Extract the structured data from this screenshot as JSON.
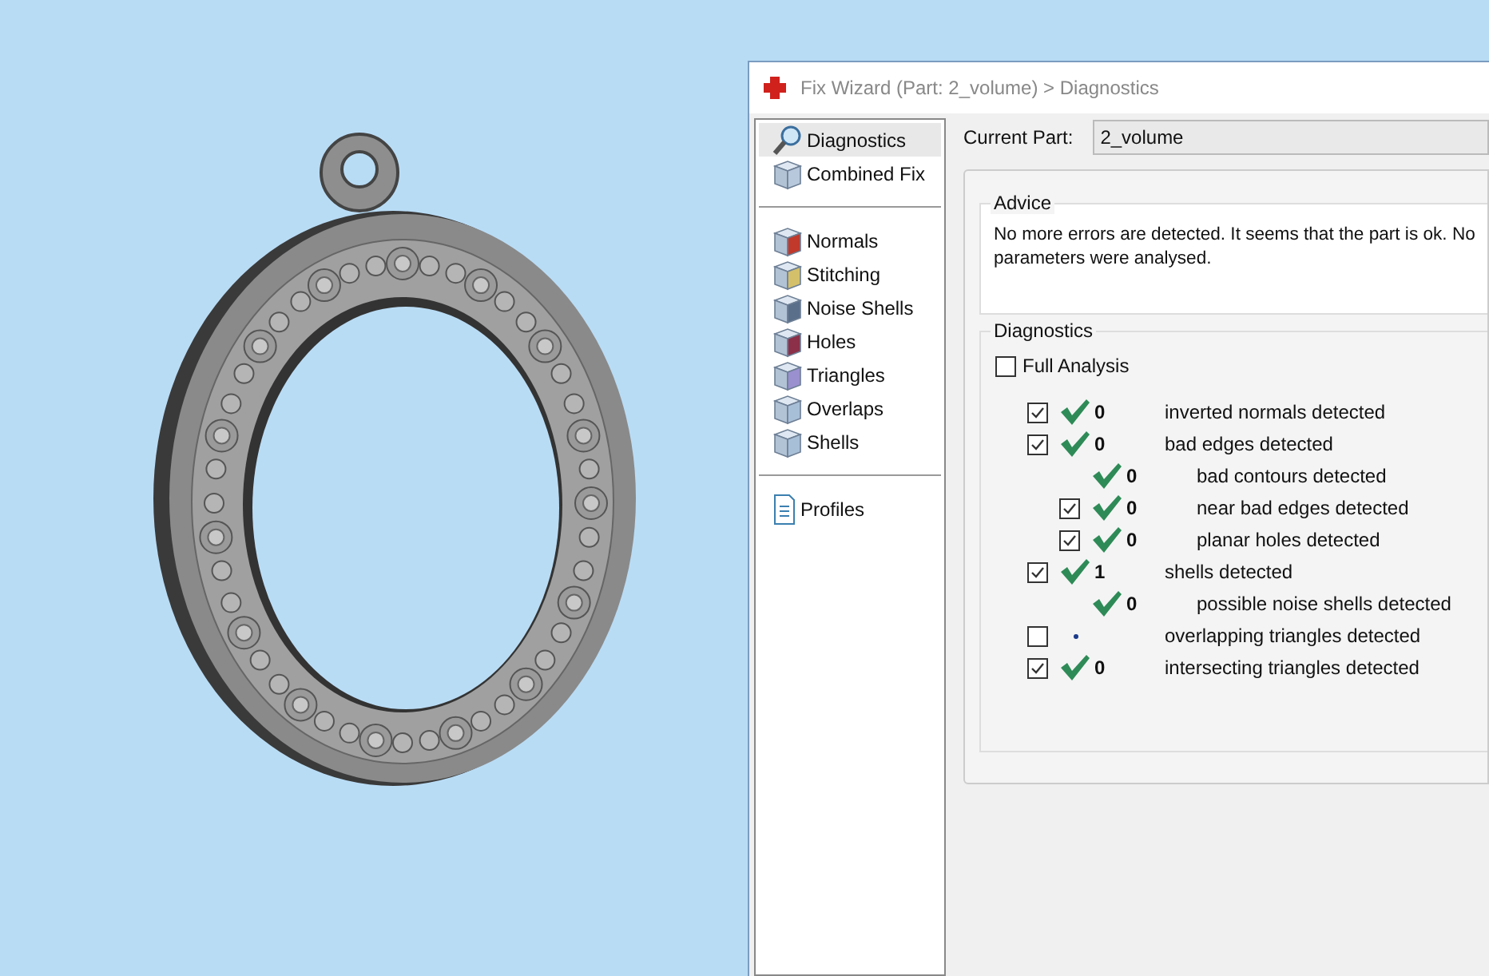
{
  "window": {
    "title": "Fix Wizard (Part: 2_volume) > Diagnostics"
  },
  "sidebar": {
    "groups": [
      {
        "items": [
          {
            "label": "Diagnostics",
            "selected": true
          },
          {
            "label": "Combined Fix",
            "selected": false
          }
        ]
      },
      {
        "items": [
          {
            "label": "Normals",
            "selected": false
          },
          {
            "label": "Stitching",
            "selected": false
          },
          {
            "label": "Noise Shells",
            "selected": false
          },
          {
            "label": "Holes",
            "selected": false
          },
          {
            "label": "Triangles",
            "selected": false
          },
          {
            "label": "Overlaps",
            "selected": false
          },
          {
            "label": "Shells",
            "selected": false
          }
        ]
      },
      {
        "items": [
          {
            "label": "Profiles",
            "selected": false
          }
        ]
      }
    ]
  },
  "current_part": {
    "label": "Current Part:",
    "value": "2_volume"
  },
  "advice": {
    "title": "Advice",
    "lines": [
      "No more errors are detected. It seems that the part is ok. No",
      "parameters were analysed."
    ]
  },
  "diagnostics": {
    "title": "Diagnostics",
    "full_analysis": {
      "label": "Full Analysis",
      "checked": false
    },
    "rows": [
      {
        "kind": "main",
        "checked": true,
        "passed": true,
        "count": "0",
        "label": "inverted normals detected"
      },
      {
        "kind": "main",
        "checked": true,
        "passed": true,
        "count": "0",
        "label": "bad edges detected"
      },
      {
        "kind": "detail",
        "passed": true,
        "count": "0",
        "label": "bad contours detected"
      },
      {
        "kind": "sub",
        "checked": true,
        "passed": true,
        "count": "0",
        "label": "near bad edges detected"
      },
      {
        "kind": "sub",
        "checked": true,
        "passed": true,
        "count": "0",
        "label": "planar holes detected"
      },
      {
        "kind": "main",
        "checked": true,
        "passed": true,
        "count": "1",
        "label": "shells detected"
      },
      {
        "kind": "detail",
        "passed": true,
        "count": "0",
        "label": "possible noise shells detected"
      },
      {
        "kind": "main",
        "checked": false,
        "passed": false,
        "label": "overlapping triangles detected"
      },
      {
        "kind": "main",
        "checked": true,
        "passed": true,
        "count": "0",
        "label": "intersecting triangles detected"
      }
    ]
  }
}
